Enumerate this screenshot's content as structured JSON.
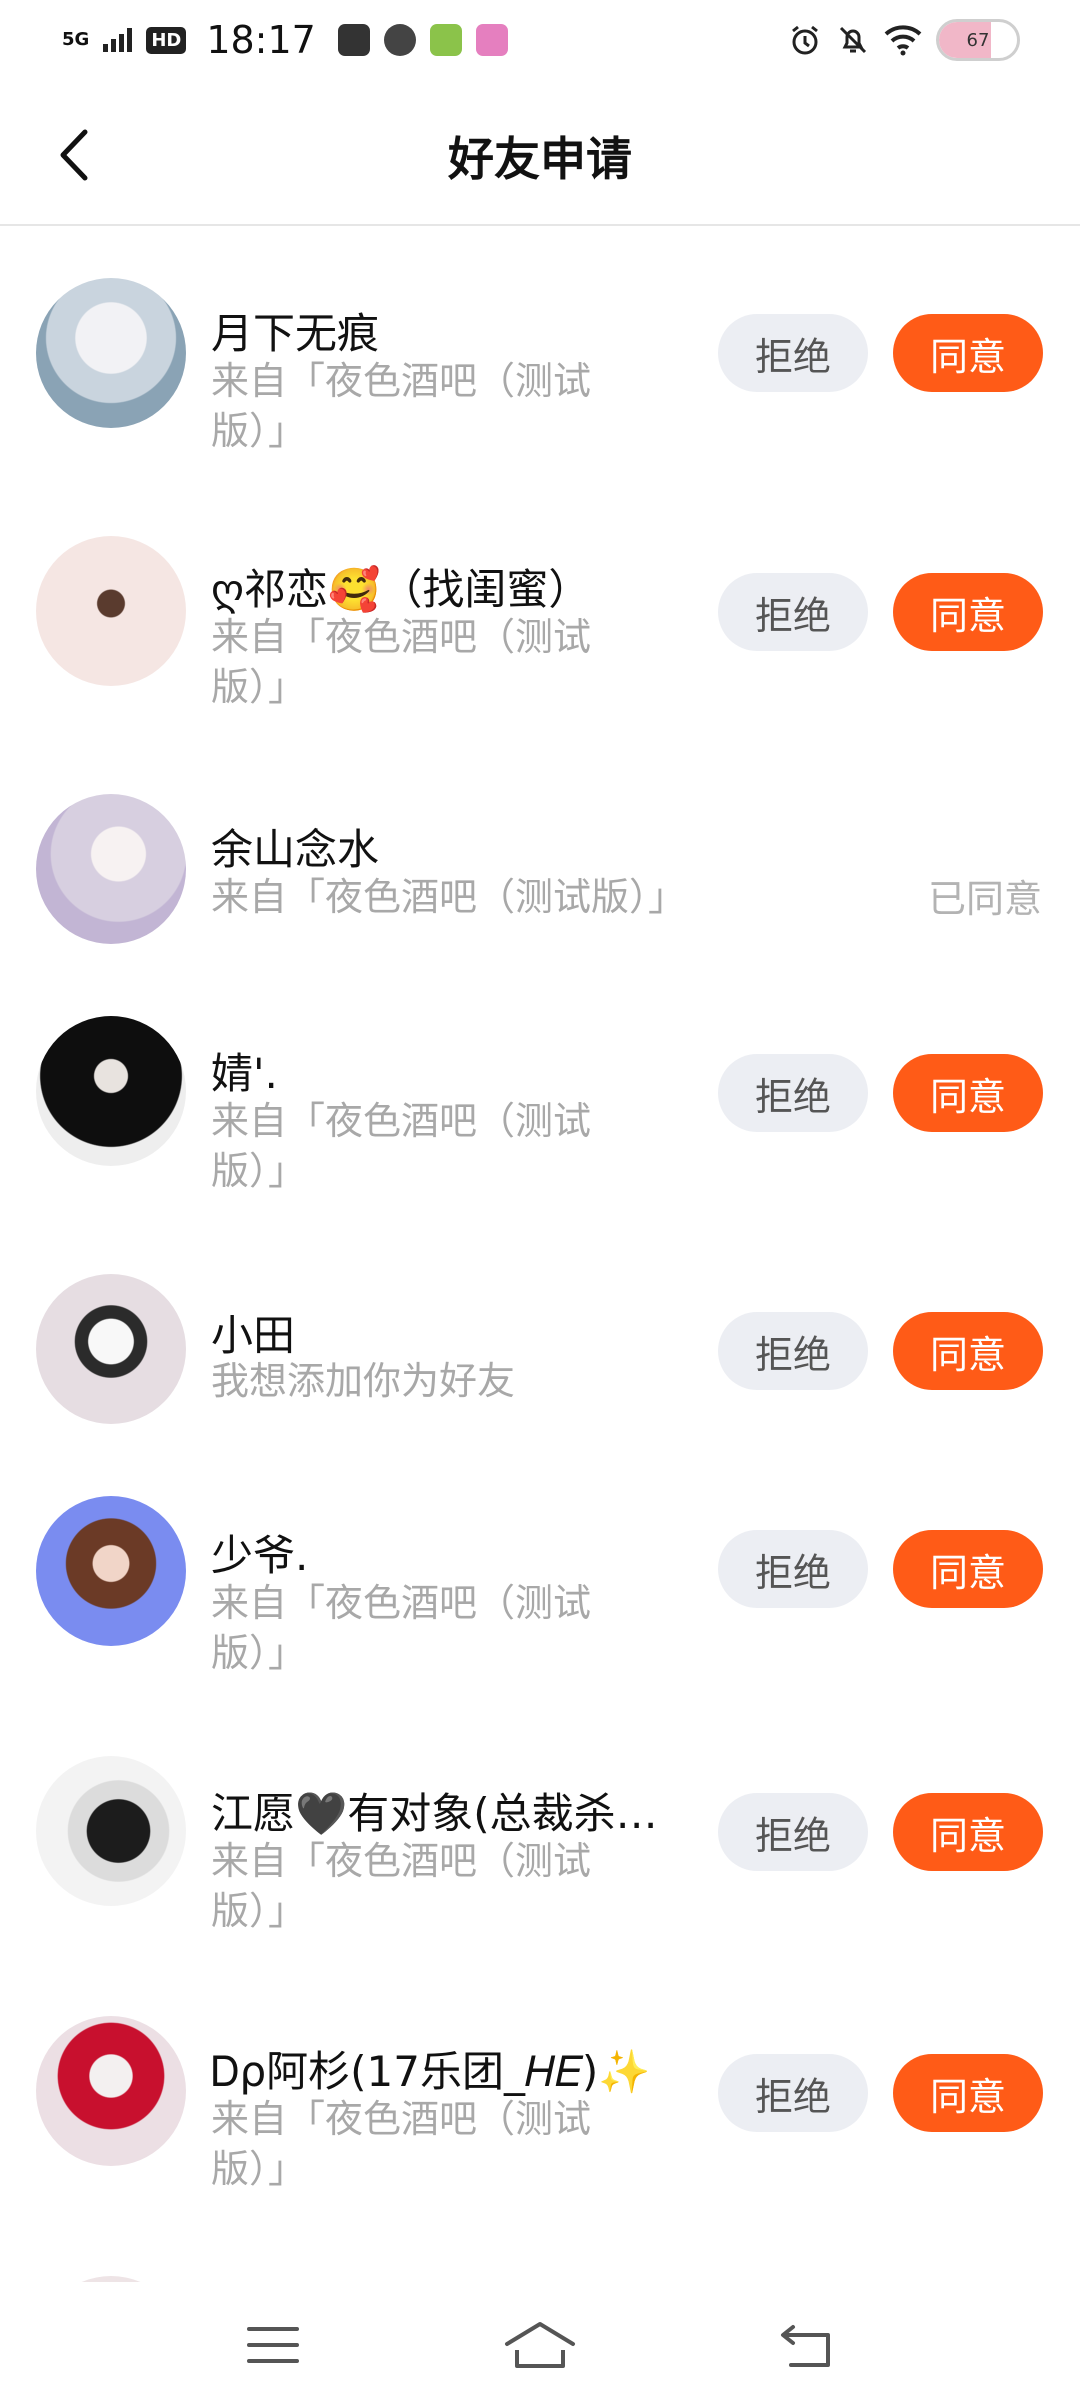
{
  "status_bar": {
    "network": "5G",
    "hd": "HD",
    "time": "18:17",
    "battery": "67",
    "battery_level": 0.67
  },
  "header": {
    "title": "好友申请"
  },
  "buttons": {
    "reject": "拒绝",
    "accept": "同意"
  },
  "requests": [
    {
      "name": "月下无痕",
      "source_line1": "来自「夜色酒吧（测试",
      "source_line2": "版）」",
      "status": "pending"
    },
    {
      "name": "ღ祁恋🥰（找闺蜜）",
      "source_line1": "来自「夜色酒吧（测试",
      "source_line2": "版）」",
      "status": "pending"
    },
    {
      "name": "余山念水",
      "source_line1": "来自「夜色酒吧（测试版）」",
      "source_line2": "",
      "status": "agreed",
      "status_label": "已同意"
    },
    {
      "name": "婧'.",
      "source_line1": "来自「夜色酒吧（测试",
      "source_line2": "版）」",
      "status": "pending"
    },
    {
      "name": "小田",
      "source_line1": "我想添加你为好友",
      "source_line2": "",
      "status": "pending"
    },
    {
      "name": "少爷.",
      "source_line1": "来自「夜色酒吧（测试",
      "source_line2": "版）」",
      "status": "pending"
    },
    {
      "name": "江愿🖤有对象(总裁杀…",
      "source_line1": "来自「夜色酒吧（测试",
      "source_line2": "版）」",
      "status": "pending"
    },
    {
      "name": "Ꭰρ阿杉(17乐团_𝐻𝐸)✨",
      "source_line1": "来自「夜色酒吧（测试",
      "source_line2": "版）」",
      "status": "pending"
    }
  ],
  "navbar": {
    "icons": [
      "menu-icon",
      "home-icon",
      "back-icon"
    ]
  },
  "colors": {
    "accent": "#ff5b17",
    "reject_bg": "#eceef3",
    "muted_text": "#a8a8a8"
  }
}
